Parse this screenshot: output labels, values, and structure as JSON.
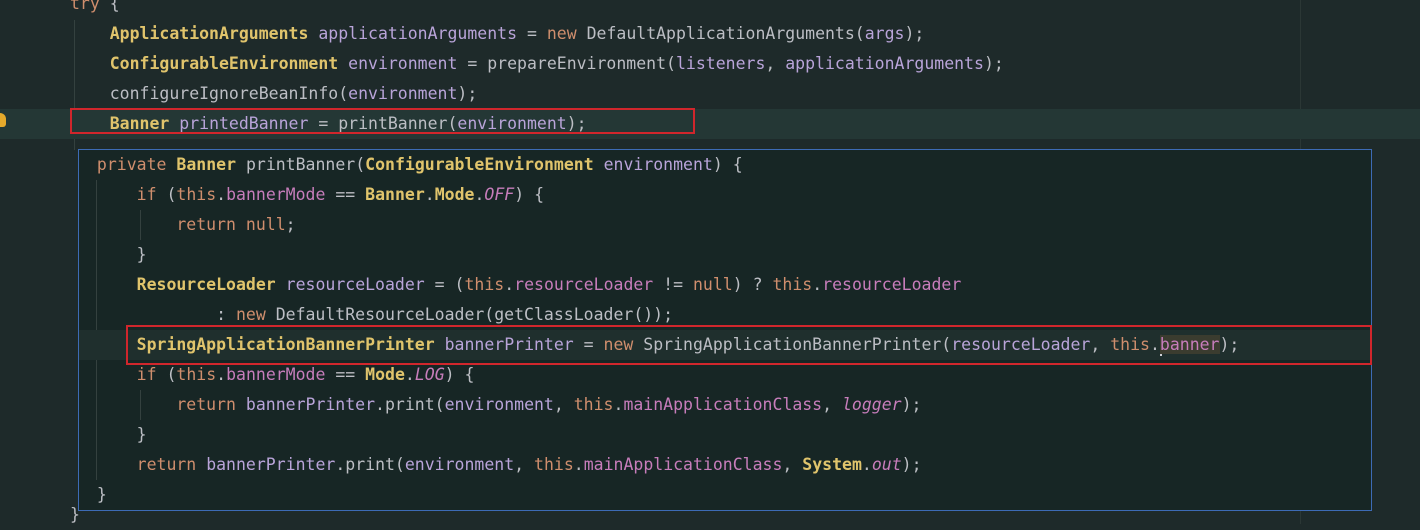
{
  "editor": {
    "lines": [
      {
        "indent": "  ",
        "tokens": [
          [
            "kw",
            "try"
          ],
          [
            "pl",
            " {"
          ]
        ]
      },
      {
        "indent": "      ",
        "tokens": [
          [
            "ty",
            "ApplicationArguments"
          ],
          [
            "pl",
            " "
          ],
          [
            "va",
            "applicationArguments"
          ],
          [
            "pl",
            " = "
          ],
          [
            "kw",
            "new"
          ],
          [
            "pl",
            " DefaultApplicationArguments("
          ],
          [
            "va",
            "args"
          ],
          [
            "pl",
            ");"
          ]
        ]
      },
      {
        "indent": "      ",
        "tokens": [
          [
            "ty",
            "ConfigurableEnvironment"
          ],
          [
            "pl",
            " "
          ],
          [
            "va",
            "environment"
          ],
          [
            "pl",
            " = prepareEnvironment("
          ],
          [
            "va",
            "listeners"
          ],
          [
            "pl",
            ", "
          ],
          [
            "va",
            "applicationArguments"
          ],
          [
            "pl",
            ");"
          ]
        ]
      },
      {
        "indent": "      ",
        "tokens": [
          [
            "pl",
            "configureIgnoreBeanInfo("
          ],
          [
            "va",
            "environment"
          ],
          [
            "pl",
            ");"
          ]
        ]
      },
      {
        "indent": "      ",
        "tokens": [
          [
            "ty",
            "Banner"
          ],
          [
            "pl",
            " "
          ],
          [
            "va",
            "printedBanner"
          ],
          [
            "pl",
            " = printBanner("
          ],
          [
            "va",
            "environment"
          ],
          [
            "pl",
            ");"
          ]
        ]
      }
    ],
    "closing_brace": "}"
  },
  "popup": {
    "lines": [
      {
        "indent": " ",
        "tokens": [
          [
            "kw",
            "private"
          ],
          [
            "pl",
            " "
          ],
          [
            "ty",
            "Banner"
          ],
          [
            "pl",
            " printBanner("
          ],
          [
            "ty",
            "ConfigurableEnvironment"
          ],
          [
            "pl",
            " "
          ],
          [
            "va",
            "environment"
          ],
          [
            "pl",
            ") {"
          ]
        ]
      },
      {
        "indent": "     ",
        "tokens": [
          [
            "kw",
            "if"
          ],
          [
            "pl",
            " ("
          ],
          [
            "kw",
            "this"
          ],
          [
            "pl",
            "."
          ],
          [
            "fd",
            "bannerMode"
          ],
          [
            "pl",
            " == "
          ],
          [
            "ty",
            "Banner"
          ],
          [
            "pl",
            "."
          ],
          [
            "ty",
            "Mode"
          ],
          [
            "pl",
            "."
          ],
          [
            "fd ital",
            "OFF"
          ],
          [
            "pl",
            ") {"
          ]
        ]
      },
      {
        "indent": "         ",
        "tokens": [
          [
            "kw",
            "return"
          ],
          [
            "pl",
            " "
          ],
          [
            "kw",
            "null"
          ],
          [
            "pl",
            ";"
          ]
        ]
      },
      {
        "indent": "     ",
        "tokens": [
          [
            "pl",
            "}"
          ]
        ]
      },
      {
        "indent": "     ",
        "tokens": [
          [
            "ty",
            "ResourceLoader"
          ],
          [
            "pl",
            " "
          ],
          [
            "va",
            "resourceLoader"
          ],
          [
            "pl",
            " = ("
          ],
          [
            "kw",
            "this"
          ],
          [
            "pl",
            "."
          ],
          [
            "fd",
            "resourceLoader"
          ],
          [
            "pl",
            " != "
          ],
          [
            "kw",
            "null"
          ],
          [
            "pl",
            ") ? "
          ],
          [
            "kw",
            "this"
          ],
          [
            "pl",
            "."
          ],
          [
            "fd",
            "resourceLoader"
          ]
        ]
      },
      {
        "indent": "             ",
        "tokens": [
          [
            "pl",
            ": "
          ],
          [
            "kw",
            "new"
          ],
          [
            "pl",
            " DefaultResourceLoader(getClassLoader());"
          ]
        ]
      },
      {
        "indent": "     ",
        "tokens": [
          [
            "ty",
            "SpringApplicationBannerPrinter"
          ],
          [
            "pl",
            " "
          ],
          [
            "va",
            "bannerPrinter"
          ],
          [
            "pl",
            " = "
          ],
          [
            "kw",
            "new"
          ],
          [
            "pl",
            " SpringApplicationBannerPrinter("
          ],
          [
            "va",
            "resourceLoader"
          ],
          [
            "pl",
            ", "
          ],
          [
            "kw",
            "this"
          ],
          [
            "pl",
            "."
          ],
          [
            "caret",
            ""
          ],
          [
            "fd wordhl",
            "banner"
          ],
          [
            "pl",
            ");"
          ]
        ]
      },
      {
        "indent": "     ",
        "tokens": [
          [
            "kw",
            "if"
          ],
          [
            "pl",
            " ("
          ],
          [
            "kw",
            "this"
          ],
          [
            "pl",
            "."
          ],
          [
            "fd",
            "bannerMode"
          ],
          [
            "pl",
            " == "
          ],
          [
            "ty",
            "Mode"
          ],
          [
            "pl",
            "."
          ],
          [
            "fd ital",
            "LOG"
          ],
          [
            "pl",
            ") {"
          ]
        ]
      },
      {
        "indent": "         ",
        "tokens": [
          [
            "kw",
            "return"
          ],
          [
            "pl",
            " "
          ],
          [
            "va",
            "bannerPrinter"
          ],
          [
            "pl",
            ".print("
          ],
          [
            "va",
            "environment"
          ],
          [
            "pl",
            ", "
          ],
          [
            "kw",
            "this"
          ],
          [
            "pl",
            "."
          ],
          [
            "fd",
            "mainApplicationClass"
          ],
          [
            "pl",
            ", "
          ],
          [
            "fd ital",
            "logger"
          ],
          [
            "pl",
            ");"
          ]
        ]
      },
      {
        "indent": "     ",
        "tokens": [
          [
            "pl",
            "}"
          ]
        ]
      },
      {
        "indent": "     ",
        "tokens": [
          [
            "kw",
            "return"
          ],
          [
            "pl",
            " "
          ],
          [
            "va",
            "bannerPrinter"
          ],
          [
            "pl",
            ".print("
          ],
          [
            "va",
            "environment"
          ],
          [
            "pl",
            ", "
          ],
          [
            "kw",
            "this"
          ],
          [
            "pl",
            "."
          ],
          [
            "fd",
            "mainApplicationClass"
          ],
          [
            "pl",
            ", "
          ],
          [
            "ty",
            "System"
          ],
          [
            "pl",
            "."
          ],
          [
            "fd ital",
            "out"
          ],
          [
            "pl",
            ");"
          ]
        ]
      },
      {
        "indent": " ",
        "tokens": [
          [
            "pl",
            "}"
          ]
        ]
      }
    ]
  },
  "intention_icon": "lightbulb-icon",
  "colors": {
    "keyword": "#cf8e6d",
    "type": "#e0c46c",
    "variable": "#b9a4d9",
    "field": "#c77dbb",
    "highlight_box": "#d0262c",
    "popup_border": "#3d6bb5"
  }
}
